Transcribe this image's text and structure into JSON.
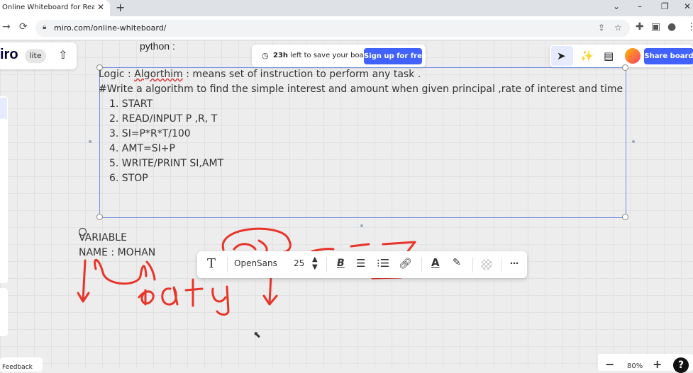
{
  "browser": {
    "tab_title": "Online Whiteboard for Realtime C",
    "tab_close": "✕",
    "new_tab": "+",
    "url": "miro.com/online-whiteboard/",
    "window_controls": [
      "⌄",
      "–",
      "❐",
      "✕"
    ]
  },
  "board": {
    "logo": "iro",
    "badge": "lite",
    "python_text": "python :",
    "banner": {
      "time": "23h",
      "text": "left to save your board.",
      "signup_label": "Sign up for free"
    },
    "share_label": "Share board",
    "text_heading": [
      "Logic : ",
      "Algorthim",
      " : means set of instruction to perform any task ."
    ],
    "text_line2": "#Write a algorithm to find the simple interest and amount when given principal ,rate of interest and time",
    "steps": [
      "1. START",
      "2. READ/INPUT  P ,R, T",
      "3. SI=P*R*T/100",
      "4. AMT=SI+P",
      "5. WRITE/PRINT SI,AMT",
      "6. STOP"
    ],
    "variable_lines": [
      "VARIABLE",
      "NAME :  MOHAN"
    ],
    "feedback_label": "Feedback",
    "zoom_level": "80%"
  },
  "format_toolbar": {
    "font": "OpenSans",
    "size": "25"
  },
  "colors": {
    "accent": "#4262ff",
    "ink": "#e8352a",
    "selection": "#6e8ee0"
  }
}
